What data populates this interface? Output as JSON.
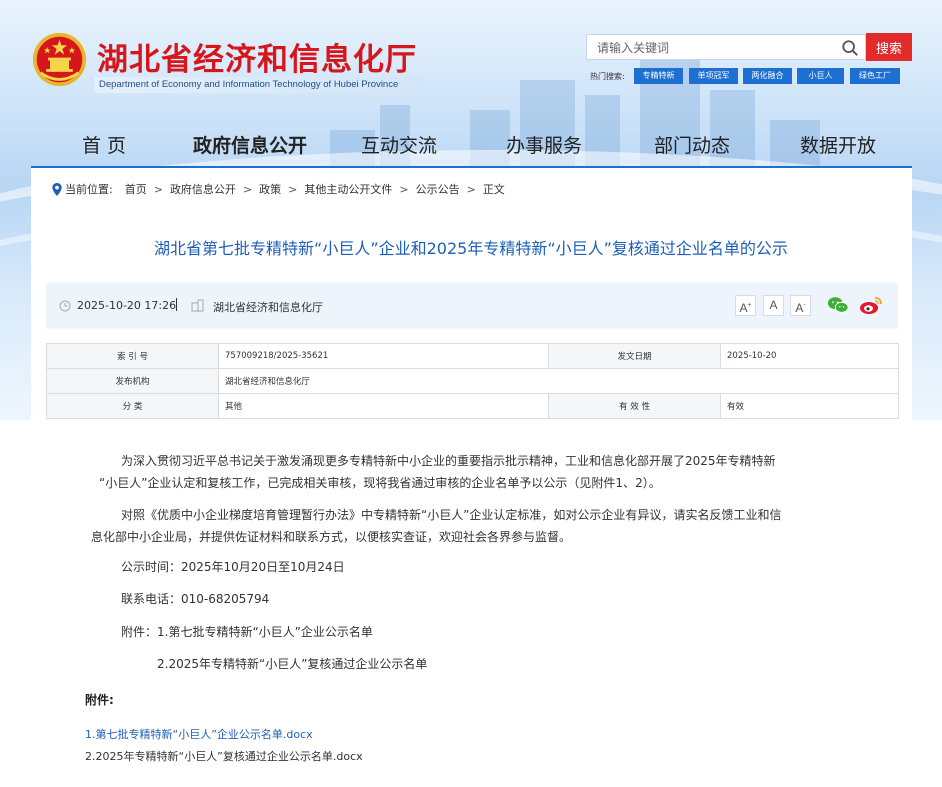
{
  "header": {
    "site_title": "湖北省经济和信息化厅",
    "site_subtitle": "Department of Economy and Information Technology of Hubei Province",
    "search": {
      "placeholder": "请输入关键词",
      "button_label": "搜索"
    },
    "hot_label": "热门搜索:",
    "hot_tags": [
      "专精特新",
      "单项冠军",
      "两化融合",
      "小巨人",
      "绿色工厂"
    ]
  },
  "nav": {
    "items": [
      "首  页",
      "政府信息公开",
      "互动交流",
      "办事服务",
      "部门动态",
      "数据开放"
    ],
    "active_index": 1
  },
  "breadcrumb": {
    "label": "当前位置:",
    "items": [
      "首页",
      "政府信息公开",
      "政策",
      "其他主动公开文件",
      "公示公告",
      "正文"
    ],
    "separator": ">"
  },
  "article": {
    "title": "湖北省第七批专精特新“小巨人”企业和2025年专精特新“小巨人”复核通过企业名单的公示",
    "date": "2025-10-20 17:26",
    "source": "湖北省经济和信息化厅",
    "font_buttons": [
      "A+",
      "A",
      "A-"
    ]
  },
  "info_table": {
    "rows": [
      {
        "k1": "索 引 号",
        "v1": "757009218/2025-35621",
        "k2": "发文日期",
        "v2": "2025-10-20"
      },
      {
        "k1": "发布机构",
        "v1": "湖北省经济和信息化厅"
      },
      {
        "k1": "分      类",
        "v1": "其他",
        "k2": "有 效 性",
        "v2": "有效"
      }
    ]
  },
  "body": {
    "p1": [
      "为深入贯彻习近平总书记关于激发涌现更多专精特新中小企业的重要指示批示精神，工业和信息化部开展了2025年专精特新",
      "“小巨人”企业认定和复核工作，已完成相关审核，现将我省通过审核的企业名单予以公示（见附件1、2）。"
    ],
    "p2": [
      "对照《优质中小企业梯度培育管理暂行办法》中专精特新“小巨人”企业认定标准，如对公示企业有异议，请实名反馈工业和信",
      "息化部中小企业局，并提供佐证材料和联系方式，以便核实查证，欢迎社会各界参与监督。"
    ],
    "period": "公示时间：2025年10月20日至10月24日",
    "phone": "联系电话：010-68205794",
    "attach_1": "附件：1.第七批专精特新“小巨人”企业公示名单",
    "attach_2": "2.2025年专精特新“小巨人”复核通过企业公示名单"
  },
  "attachments": {
    "heading": "附件:",
    "files": [
      "1.第七批专精特新“小巨人”企业公示名单.docx",
      "2.2025年专精特新“小巨人”复核通过企业公示名单.docx"
    ]
  },
  "colors": {
    "brand_red": "#d6161b",
    "accent_blue": "#1d6fd1",
    "link_blue": "#1d5fb8",
    "search_red": "#e32b2b"
  }
}
